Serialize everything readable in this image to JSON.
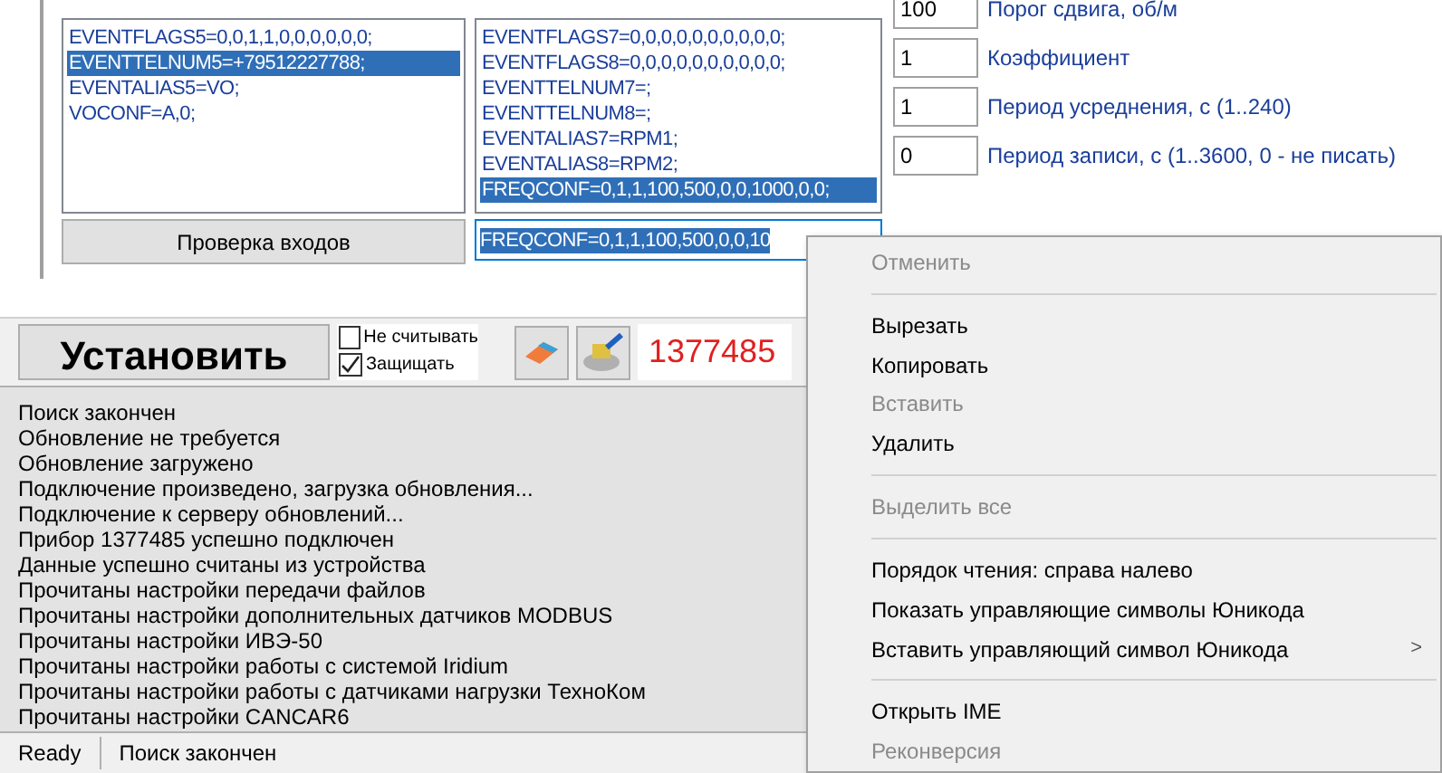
{
  "config_lists": [
    {
      "lines": [
        {
          "text": "EVENTFLAGS5=0,0,1,1,0,0,0,0,0,0;",
          "selected": false
        },
        {
          "text": "EVENTTELNUM5=+79512227788;",
          "selected": true
        },
        {
          "text": "EVENTALIAS5=VO;",
          "selected": false
        },
        {
          "text": "VOCONF=A,0;",
          "selected": false
        }
      ]
    },
    {
      "lines": [
        {
          "text": "EVENTFLAGS7=0,0,0,0,0,0,0,0,0,0;",
          "selected": false
        },
        {
          "text": "EVENTFLAGS8=0,0,0,0,0,0,0,0,0,0;",
          "selected": false
        },
        {
          "text": "EVENTTELNUM7=;",
          "selected": false
        },
        {
          "text": "EVENTTELNUM8=;",
          "selected": false
        },
        {
          "text": "EVENTALIAS7=RPM1;",
          "selected": false
        },
        {
          "text": "EVENTALIAS8=RPM2;",
          "selected": false
        },
        {
          "text": "FREQCONF=0,1,1,100,500,0,0,1000,0,0;",
          "selected": true
        }
      ]
    }
  ],
  "check_inputs_button": "Проверка входов",
  "edit_field": {
    "value": "FREQCONF=0,1,1,100,500,0,0,10"
  },
  "parameters": [
    {
      "value": "100",
      "label": "Порог сдвига, об/м"
    },
    {
      "value": "1",
      "label": "Коэффициент"
    },
    {
      "value": "1",
      "label": "Период усреднения, с (1..240)"
    },
    {
      "value": "0",
      "label": "Период записи, с (1..3600, 0 - не писать)"
    }
  ],
  "install_button": "Установить",
  "options": [
    {
      "label": "Не считывать",
      "checked": false
    },
    {
      "label": "Защищать",
      "checked": true
    }
  ],
  "device_number": "1377485",
  "log": [
    "Поиск закончен",
    "Обновление не требуется",
    "Обновление загружено",
    "Подключение произведено, загрузка обновления...",
    "Подключение к серверу обновлений...",
    "Прибор 1377485 успешно подключен",
    "Данные успешно считаны из устройства",
    "Прочитаны настройки передачи файлов",
    "Прочитаны настройки дополнительных датчиков MODBUS",
    "Прочитаны настройки ИВЭ-50",
    "Прочитаны настройки работы с системой Iridium",
    "Прочитаны настройки работы с датчиками нагрузки ТехноКом",
    "Прочитаны настройки CANCAR6"
  ],
  "status_bar": [
    "Ready",
    "Поиск закончен"
  ],
  "context_menu": [
    {
      "kind": "item",
      "label": "Отменить",
      "disabled": true
    },
    {
      "kind": "separator"
    },
    {
      "kind": "item",
      "label": "Вырезать",
      "disabled": false
    },
    {
      "kind": "item",
      "label": "Копировать",
      "disabled": false
    },
    {
      "kind": "item",
      "label": "Вставить",
      "disabled": true
    },
    {
      "kind": "item",
      "label": "Удалить",
      "disabled": false
    },
    {
      "kind": "separator"
    },
    {
      "kind": "item",
      "label": "Выделить все",
      "disabled": true
    },
    {
      "kind": "separator"
    },
    {
      "kind": "item",
      "label": "Порядок чтения: справа налево",
      "disabled": false
    },
    {
      "kind": "item",
      "label": "Показать управляющие символы Юникода",
      "disabled": false
    },
    {
      "kind": "submenu",
      "label": "Вставить управляющий символ Юникода",
      "disabled": false,
      "arrow": ">"
    },
    {
      "kind": "separator"
    },
    {
      "kind": "item",
      "label": "Открыть IME",
      "disabled": false
    },
    {
      "kind": "item",
      "label": "Реконверсия",
      "disabled": true
    }
  ]
}
